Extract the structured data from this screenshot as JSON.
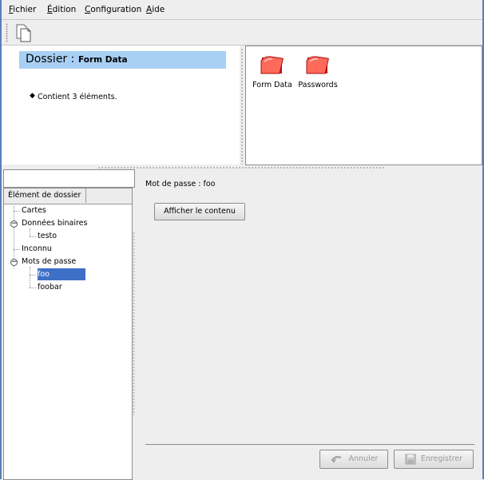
{
  "menubar": {
    "items": [
      {
        "accel": "F",
        "rest": "ichier"
      },
      {
        "accel": "É",
        "rest": "dition"
      },
      {
        "accel": "C",
        "rest": "onfiguration"
      },
      {
        "accel": "A",
        "rest": "ide"
      }
    ]
  },
  "toolbar": {
    "new_icon": "new-document-icon"
  },
  "info": {
    "dossier_label": "Dossier :",
    "dossier_name": "Form Data",
    "bullet": "◆",
    "contains_text": "Contient 3 éléments."
  },
  "icons": {
    "items": [
      {
        "label": "Form Data",
        "icon": "folder-icon"
      },
      {
        "label": "Passwords",
        "icon": "folder-icon"
      }
    ],
    "folder_color": "#e8392c"
  },
  "tree": {
    "search_value": "",
    "column_header": "Élément de dossier",
    "items": [
      {
        "label": "Cartes"
      },
      {
        "label": "Données binaires",
        "toggle": "−"
      },
      {
        "label": "testo"
      },
      {
        "label": "Inconnu"
      },
      {
        "label": "Mots de passe",
        "toggle": "−"
      },
      {
        "label": "foo",
        "selected": true
      },
      {
        "label": "foobar"
      }
    ],
    "selection_color": "#3e6fc6"
  },
  "detail": {
    "password_label": "Mot de passe : foo",
    "show_button": "Afficher le contenu",
    "cancel_button": "Annuler",
    "save_button": "Enregistrer"
  }
}
